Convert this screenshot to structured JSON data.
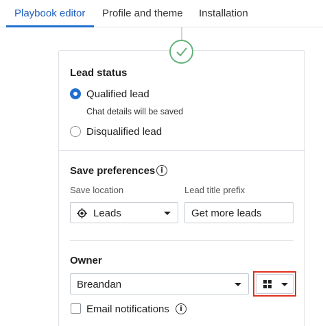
{
  "tabs": [
    {
      "label": "Playbook editor",
      "active": true
    },
    {
      "label": "Profile and theme",
      "active": false
    },
    {
      "label": "Installation",
      "active": false
    }
  ],
  "colors": {
    "accent": "#1f6fd1",
    "success": "#62b27a",
    "highlight": "#e0301e"
  },
  "lead_status": {
    "heading": "Lead status",
    "options": [
      {
        "label": "Qualified lead",
        "selected": true,
        "description": "Chat details will be saved"
      },
      {
        "label": "Disqualified lead",
        "selected": false
      }
    ]
  },
  "save_preferences": {
    "heading": "Save preferences",
    "save_location": {
      "label": "Save location",
      "value": "Leads",
      "icon": "target-icon"
    },
    "lead_title_prefix": {
      "label": "Lead title prefix",
      "value": "Get more leads"
    }
  },
  "owner": {
    "heading": "Owner",
    "value": "Breandan",
    "view_toggle_icon": "grid-icon",
    "email_notifications": {
      "label": "Email notifications",
      "checked": false
    }
  }
}
